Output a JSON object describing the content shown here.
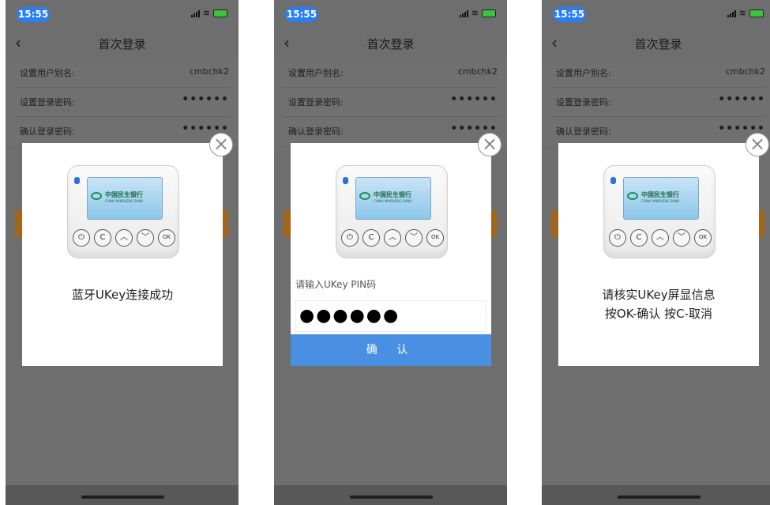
{
  "status": {
    "time": "15:55"
  },
  "nav": {
    "title": "首次登录"
  },
  "form": {
    "rows": [
      {
        "label": "设置用户别名:",
        "value": "cmbchk2"
      },
      {
        "label": "设置登录密码:",
        "value": "••••••"
      },
      {
        "label": "确认登录密码:",
        "value": "••••••"
      }
    ]
  },
  "device": {
    "bank_name": "中国民生银行",
    "bank_sub": "CHINA MINSHENG BANK",
    "keys": [
      "⏻",
      "C",
      "︿",
      "﹀",
      "OK"
    ]
  },
  "screens": [
    {
      "message": "蓝牙UKey连接成功"
    },
    {
      "pin_label": "请输入UKey PIN码",
      "pin_value": "●●●●●●",
      "confirm_label": "确 认"
    },
    {
      "message_line1": "请核实UKey屏显信息",
      "message_line2": "按OK-确认 按C-取消"
    }
  ],
  "colors": {
    "time_pill": "#2a7ef5",
    "confirm_button": "#4a90e2",
    "overlay": "#6e6e6e",
    "orange_button": "#a2651a"
  }
}
